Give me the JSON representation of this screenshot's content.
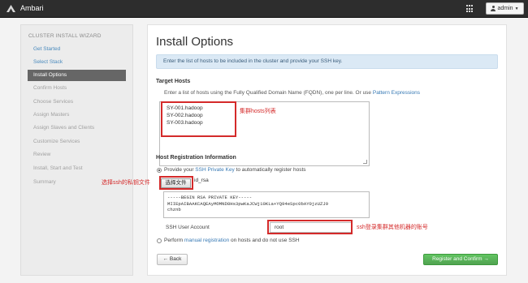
{
  "header": {
    "brand": "Ambari",
    "user": "admin"
  },
  "sidebar": {
    "title": "CLUSTER INSTALL WIZARD",
    "steps": [
      {
        "label": "Get Started",
        "state": "done"
      },
      {
        "label": "Select Stack",
        "state": "done"
      },
      {
        "label": "Install Options",
        "state": "active"
      },
      {
        "label": "Confirm Hosts",
        "state": "pending"
      },
      {
        "label": "Choose Services",
        "state": "pending"
      },
      {
        "label": "Assign Masters",
        "state": "pending"
      },
      {
        "label": "Assign Slaves and Clients",
        "state": "pending"
      },
      {
        "label": "Customize Services",
        "state": "pending"
      },
      {
        "label": "Review",
        "state": "pending"
      },
      {
        "label": "Install, Start and Test",
        "state": "pending"
      },
      {
        "label": "Summary",
        "state": "pending"
      }
    ]
  },
  "main": {
    "title": "Install Options",
    "alert": "Enter the list of hosts to be included in the cluster and provide your SSH key.",
    "target_hosts": {
      "heading": "Target Hosts",
      "hint_before": "Enter a list of hosts using the Fully Qualified Domain Name (FQDN), one per line. Or use ",
      "hint_link": "Pattern Expressions",
      "hosts": [
        "SY-001.hadoop",
        "SY-002.hadoop",
        "SY-003.hadoop"
      ]
    },
    "registration": {
      "heading": "Host Registration Information",
      "option1_before": "Provide your ",
      "option1_link": "SSH Private Key",
      "option1_after": " to automatically register hosts",
      "file_button": "选择文件",
      "file_name": "id_rsa",
      "private_key_lines": [
        "-----BEGIN RSA PRIVATE KEY-----",
        "MIIEpAIBAAKCAQEAyMOMND8Hs3pwKaJCWj10KLa+YQ94eSpc0bAY0jzUZJ9",
        "chznb"
      ],
      "ssh_user_label": "SSH User Account",
      "ssh_user_value": "root",
      "option2_before": "Perform ",
      "option2_link": "manual registration",
      "option2_after": " on hosts and do not use SSH"
    },
    "buttons": {
      "back": "← Back",
      "next": "Register and Confirm →"
    }
  },
  "annotations": {
    "hosts": "集群hosts列表",
    "ssh_key": "选择ssh的私钥文件",
    "ssh_user": "ssh登录集群其他机器的账号"
  },
  "colors": {
    "accent_red": "#d42a2a",
    "link_blue": "#3779b4",
    "success_green": "#51a351"
  }
}
